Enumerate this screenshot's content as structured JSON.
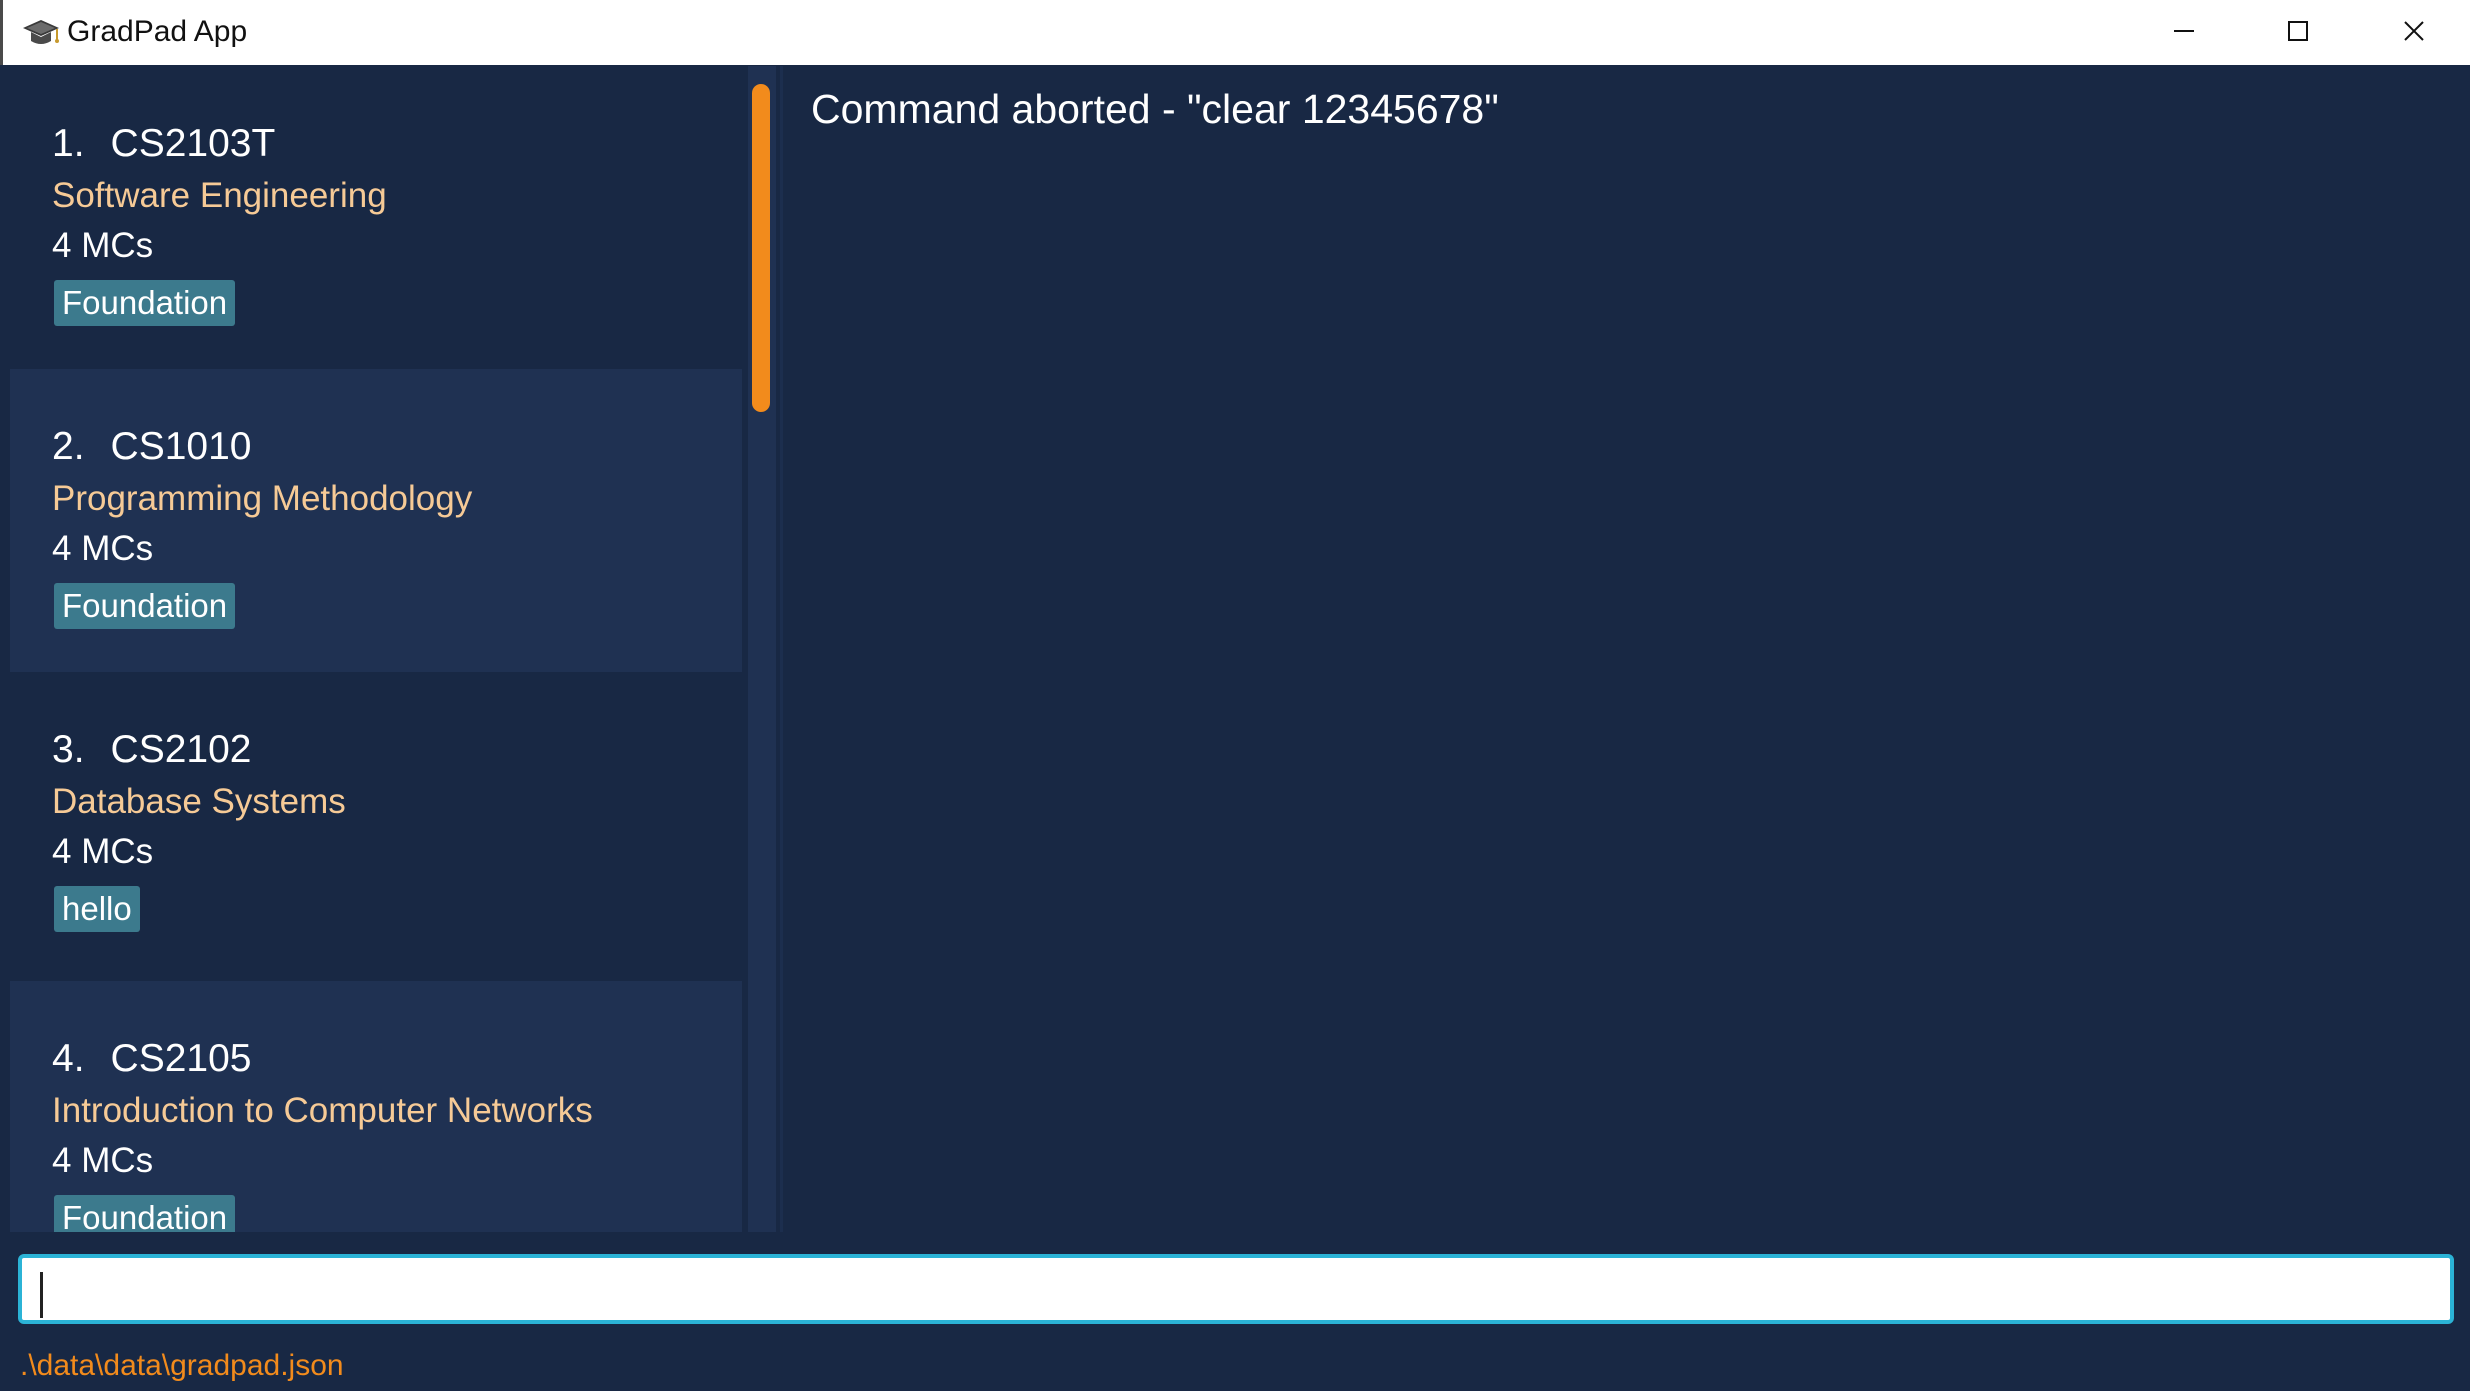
{
  "window": {
    "title": "GradPad App",
    "icon": "graduation-cap-icon",
    "controls": [
      "minimize-icon",
      "maximize-icon",
      "close-icon"
    ]
  },
  "modules": [
    {
      "index": "1.",
      "code": "CS2103T",
      "name": "Software Engineering",
      "credits": "4 MCs",
      "tag": "Foundation"
    },
    {
      "index": "2.",
      "code": "CS1010",
      "name": "Programming Methodology",
      "credits": "4 MCs",
      "tag": "Foundation"
    },
    {
      "index": "3.",
      "code": "CS2102",
      "name": "Database Systems",
      "credits": "4 MCs",
      "tag": "hello"
    },
    {
      "index": "4.",
      "code": "CS2105",
      "name": "Introduction to Computer Networks",
      "credits": "4 MCs",
      "tag": "Foundation"
    }
  ],
  "result": {
    "message": "Command aborted - \"clear 12345678\""
  },
  "command": {
    "value": "",
    "placeholder": ""
  },
  "status": {
    "file_path": ".\\data\\data\\gradpad.json"
  },
  "colors": {
    "background": "#182844",
    "card_alt": "#1f3152",
    "module_name": "#f6ca96",
    "tag": "#3c7a8d",
    "accent": "#f28b1c",
    "input_border": "#2bb3d6"
  }
}
